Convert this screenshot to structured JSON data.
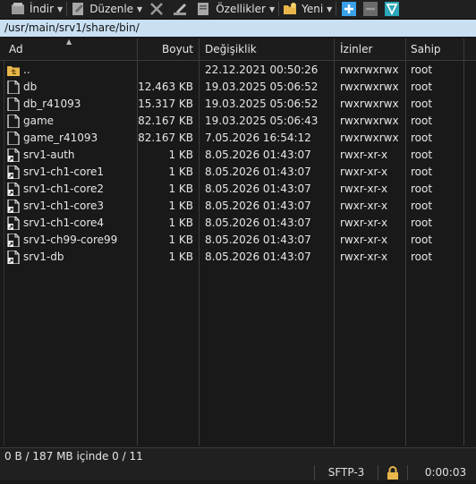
{
  "toolbar": {
    "download_label": "İndir",
    "edit_label": "Düzenle",
    "properties_label": "Özellikler",
    "new_label": "Yeni",
    "icons": [
      "download-icon",
      "edit-icon",
      "delete-icon",
      "rename-icon",
      "properties-icon",
      "new-folder-icon",
      "add-icon",
      "minus-icon",
      "filter-icon"
    ]
  },
  "path": "/usr/main/srv1/share/bin/",
  "columns": {
    "name": "Ad",
    "size": "Boyut",
    "modified": "Değişiklik",
    "permissions": "İzinler",
    "owner": "Sahip"
  },
  "files": [
    {
      "name": "..",
      "size": "",
      "modified": "22.12.2021 00:50:26",
      "permissions": "rwxrwxrwx",
      "owner": "root",
      "icon": "parent-folder-icon"
    },
    {
      "name": "db",
      "size": "12.463 KB",
      "modified": "19.03.2025 05:06:52",
      "permissions": "rwxrwxrwx",
      "owner": "root",
      "icon": "file-icon"
    },
    {
      "name": "db_r41093",
      "size": "15.317 KB",
      "modified": "19.03.2025 05:06:52",
      "permissions": "rwxrwxrwx",
      "owner": "root",
      "icon": "file-icon"
    },
    {
      "name": "game",
      "size": "82.167 KB",
      "modified": "19.03.2025 05:06:43",
      "permissions": "rwxrwxrwx",
      "owner": "root",
      "icon": "file-icon"
    },
    {
      "name": "game_r41093",
      "size": "82.167 KB",
      "modified": "7.05.2026 16:54:12",
      "permissions": "rwxrwxrwx",
      "owner": "root",
      "icon": "file-icon"
    },
    {
      "name": "srv1-auth",
      "size": "1 KB",
      "modified": "8.05.2026 01:43:07",
      "permissions": "rwxr-xr-x",
      "owner": "root",
      "icon": "shortcut-file-icon"
    },
    {
      "name": "srv1-ch1-core1",
      "size": "1 KB",
      "modified": "8.05.2026 01:43:07",
      "permissions": "rwxr-xr-x",
      "owner": "root",
      "icon": "shortcut-file-icon"
    },
    {
      "name": "srv1-ch1-core2",
      "size": "1 KB",
      "modified": "8.05.2026 01:43:07",
      "permissions": "rwxr-xr-x",
      "owner": "root",
      "icon": "shortcut-file-icon"
    },
    {
      "name": "srv1-ch1-core3",
      "size": "1 KB",
      "modified": "8.05.2026 01:43:07",
      "permissions": "rwxr-xr-x",
      "owner": "root",
      "icon": "shortcut-file-icon"
    },
    {
      "name": "srv1-ch1-core4",
      "size": "1 KB",
      "modified": "8.05.2026 01:43:07",
      "permissions": "rwxr-xr-x",
      "owner": "root",
      "icon": "shortcut-file-icon"
    },
    {
      "name": "srv1-ch99-core99",
      "size": "1 KB",
      "modified": "8.05.2026 01:43:07",
      "permissions": "rwxr-xr-x",
      "owner": "root",
      "icon": "shortcut-file-icon"
    },
    {
      "name": "srv1-db",
      "size": "1 KB",
      "modified": "8.05.2026 01:43:07",
      "permissions": "rwxr-xr-x",
      "owner": "root",
      "icon": "shortcut-file-icon"
    }
  ],
  "status": {
    "selection": "0 B / 187 MB içinde 0 / 11",
    "protocol": "SFTP-3",
    "lock_icon": "lock-icon",
    "elapsed": "0:00:03"
  },
  "colors": {
    "background": "#191919",
    "path_bar": "#c9dff2",
    "folder": "#e8b64a",
    "accent_blue": "#3aa0e8",
    "filter_teal": "#2aa7b8"
  }
}
